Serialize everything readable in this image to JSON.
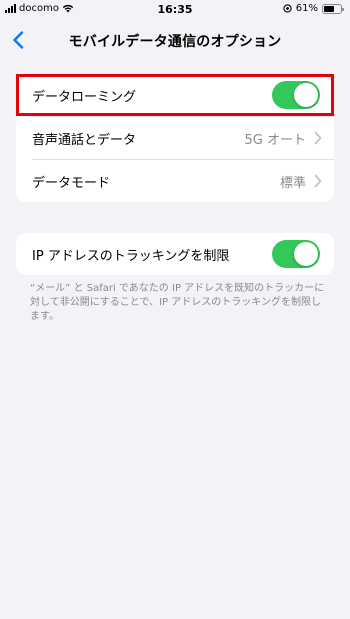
{
  "status_bar": {
    "carrier": "docomo",
    "time": "16:35",
    "battery_percent": "61%",
    "battery_level": 0.61,
    "icons": [
      "signal-icon",
      "wifi-icon",
      "location-icon",
      "battery-icon"
    ]
  },
  "nav": {
    "back_icon": "chevron-left-icon",
    "title": "モバイルデータ通信のオプション"
  },
  "group1": {
    "rows": [
      {
        "label": "データローミング",
        "toggle": true
      },
      {
        "label": "音声通話とデータ",
        "value": "5G オート"
      },
      {
        "label": "データモード",
        "value": "標準"
      }
    ]
  },
  "group2": {
    "rows": [
      {
        "label": "IP アドレスのトラッキングを制限",
        "toggle": true
      }
    ],
    "footnote": "“メール” と Safari であなたの IP アドレスを既知のトラッカーに対して非公開にすることで、IP アドレスのトラッキングを制限します。"
  },
  "colors": {
    "accent_blue": "#007aff",
    "toggle_on": "#34c759",
    "highlight_red": "#e6000b",
    "background": "#f2f2f7"
  }
}
